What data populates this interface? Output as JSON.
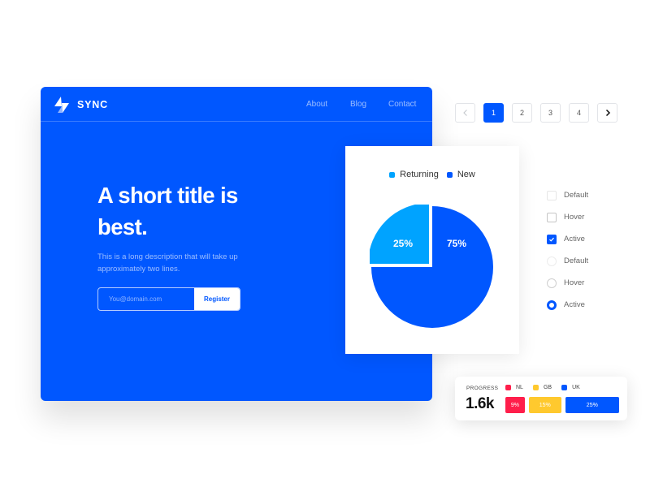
{
  "hero": {
    "brand": "SYNC",
    "logo_icon": "lightning-bolt-icon",
    "nav": [
      {
        "label": "About"
      },
      {
        "label": "Blog"
      },
      {
        "label": "Contact"
      }
    ],
    "title": "A short title is best.",
    "description": "This is a long description that will take up approximately two lines.",
    "email_placeholder": "You@domain.com",
    "email_value": "",
    "register_label": "Register",
    "bg_color": "#0057ff"
  },
  "pagination": {
    "prev_icon": "chevron-left-icon",
    "next_icon": "chevron-right-icon",
    "pages": [
      "1",
      "2",
      "3",
      "4"
    ],
    "current": "1",
    "prev_disabled": true
  },
  "checkbox_states": [
    {
      "type": "checkbox",
      "label": "Default",
      "state": "default"
    },
    {
      "type": "checkbox",
      "label": "Hover",
      "state": "hover"
    },
    {
      "type": "checkbox",
      "label": "Active",
      "state": "active",
      "checked": true
    },
    {
      "type": "radio",
      "label": "Default",
      "state": "default"
    },
    {
      "type": "radio",
      "label": "Hover",
      "state": "hover"
    },
    {
      "type": "radio",
      "label": "Active",
      "state": "active",
      "checked": true
    }
  ],
  "progress": {
    "label": "PROGRESS",
    "value": "1.6k",
    "segments": [
      {
        "name": "NL",
        "value": "9%",
        "percent": 9,
        "color": "#ff1e4b"
      },
      {
        "name": "GB",
        "value": "15%",
        "percent": 15,
        "color": "#ffc92e"
      },
      {
        "name": "UK",
        "value": "25%",
        "percent": 25,
        "color": "#0057ff"
      }
    ]
  },
  "chart_data": {
    "type": "pie",
    "title": "",
    "legend_position": "top",
    "categories": [
      "Returning",
      "New"
    ],
    "values": [
      25,
      75
    ],
    "labels": [
      "25%",
      "75%"
    ],
    "colors": [
      "#00a3ff",
      "#0057ff"
    ],
    "exploded": "Returning"
  }
}
